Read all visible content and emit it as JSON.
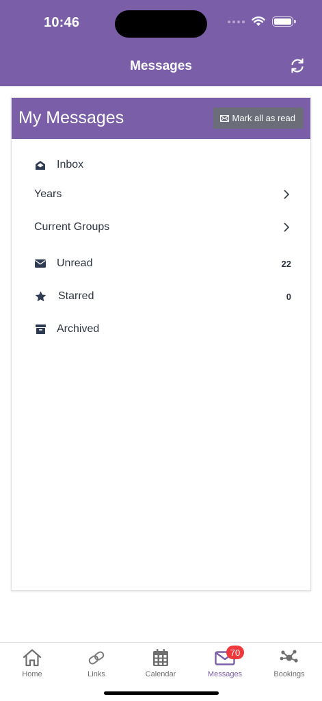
{
  "status_bar": {
    "time": "10:46"
  },
  "header": {
    "title": "Messages"
  },
  "card": {
    "title": "My Messages",
    "mark_all_label": "Mark all as read"
  },
  "menu": {
    "inbox": {
      "label": "Inbox",
      "icon": "envelope-open-icon"
    },
    "years": {
      "label": "Years"
    },
    "current_groups": {
      "label": "Current Groups"
    },
    "unread": {
      "label": "Unread",
      "count": "22",
      "icon": "envelope-icon"
    },
    "starred": {
      "label": "Starred",
      "count": "0",
      "icon": "star-icon"
    },
    "archived": {
      "label": "Archived",
      "icon": "archive-box-icon"
    }
  },
  "tabs": [
    {
      "label": "Home",
      "icon": "home-icon"
    },
    {
      "label": "Links",
      "icon": "link-icon"
    },
    {
      "label": "Calendar",
      "icon": "calendar-icon"
    },
    {
      "label": "Messages",
      "icon": "envelope-icon",
      "badge": "70",
      "active": true
    },
    {
      "label": "Bookings",
      "icon": "network-icon"
    }
  ],
  "colors": {
    "brand": "#7a5ea8",
    "badge": "#f0393c",
    "button": "#6b6e78"
  }
}
